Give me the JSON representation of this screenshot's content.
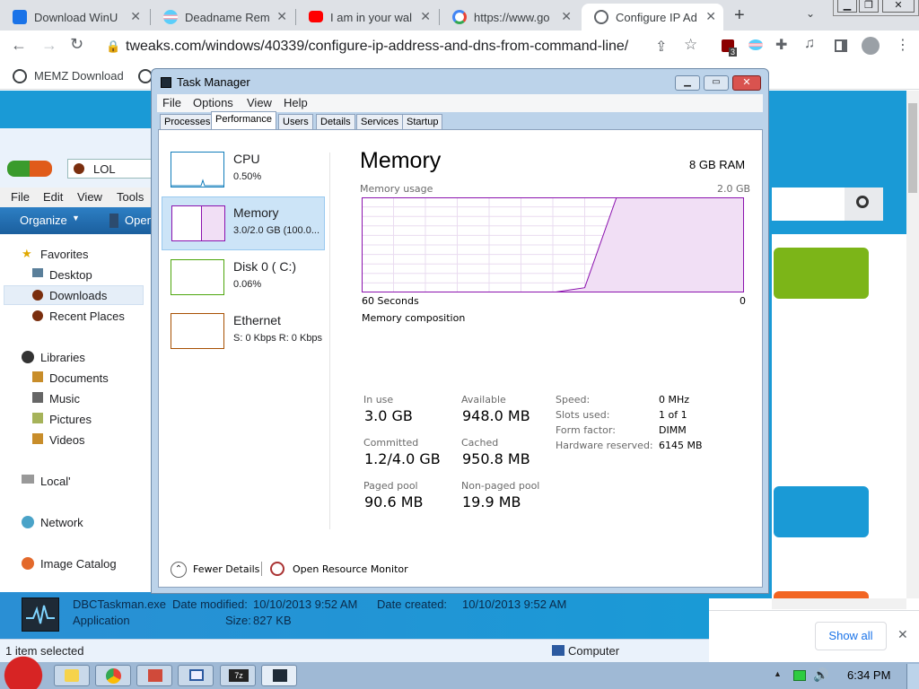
{
  "browser": {
    "tabs": [
      {
        "label": "Download WinU",
        "icon": "gear-icon",
        "color": "#1a73e8"
      },
      {
        "label": "Deadname Rem",
        "icon": "trans-flag-icon",
        "color": "#f5a9b8"
      },
      {
        "label": "I am in your wal",
        "icon": "youtube-icon",
        "color": "#ff0000"
      },
      {
        "label": "https://www.go",
        "icon": "google-icon",
        "color": "#4285f4"
      },
      {
        "label": "Configure IP Ad",
        "icon": "globe-icon",
        "color": "#5f6368"
      }
    ],
    "new_tab": "+",
    "url": "tweaks.com/windows/40339/configure-ip-address-and-dns-from-command-line/",
    "bookmark": "MEMZ Download",
    "ext_badge": "3"
  },
  "page": {
    "show_all": "Show all"
  },
  "explorer": {
    "breadcrumb": "LOL",
    "menu": [
      "File",
      "Edit",
      "View",
      "Tools"
    ],
    "organize": "Organize",
    "open": "Open",
    "nav": {
      "favorites": "Favorites",
      "desktop": "Desktop",
      "downloads": "Downloads",
      "recent": "Recent Places",
      "libraries": "Libraries",
      "documents": "Documents",
      "music": "Music",
      "pictures": "Pictures",
      "videos": "Videos",
      "local": "Local'",
      "network": "Network",
      "image_catalog": "Image Catalog"
    },
    "details": {
      "filename": "DBCTaskman.exe",
      "date_modified_label": "Date modified:",
      "date_modified": "10/10/2013 9:52 AM",
      "date_created_label": "Date created:",
      "date_created": "10/10/2013 9:52 AM",
      "type": "Application",
      "size_label": "Size:",
      "size": "827 KB"
    },
    "status": "1 item selected",
    "computer": "Computer"
  },
  "task_manager": {
    "title": "Task Manager",
    "menu": [
      "File",
      "Options",
      "View",
      "Help"
    ],
    "tabs": [
      "Processes",
      "Performance",
      "Users",
      "Details",
      "Services",
      "Startup"
    ],
    "sidebar": [
      {
        "name": "CPU",
        "value": "0.50%"
      },
      {
        "name": "Memory",
        "value": "3.0/2.0 GB (100.0..."
      },
      {
        "name": "Disk 0 ( C:)",
        "value": "0.06%"
      },
      {
        "name": "Ethernet",
        "value": "S: 0 Kbps R: 0 Kbps"
      }
    ],
    "heading": "Memory",
    "total": "8 GB RAM",
    "usage_label": "Memory usage",
    "usage_max": "2.0 GB",
    "x_left": "60 Seconds",
    "x_right": "0",
    "composition_label": "Memory composition",
    "stats": {
      "in_use_label": "In use",
      "in_use": "3.0 GB",
      "available_label": "Available",
      "available": "948.0 MB",
      "committed_label": "Committed",
      "committed": "1.2/4.0 GB",
      "cached_label": "Cached",
      "cached": "950.8 MB",
      "paged_label": "Paged pool",
      "paged": "90.6 MB",
      "nonpaged_label": "Non-paged pool",
      "nonpaged": "19.9 MB"
    },
    "hardware": {
      "speed_label": "Speed:",
      "speed": "0 MHz",
      "slots_label": "Slots used:",
      "slots": "1 of 1",
      "form_label": "Form factor:",
      "form": "DIMM",
      "reserved_label": "Hardware reserved:",
      "reserved": "6145 MB"
    },
    "fewer_details": "Fewer Details",
    "open_monitor": "Open Resource Monitor"
  },
  "chart_data": {
    "type": "area",
    "x": [
      60,
      55,
      50,
      45,
      40,
      35,
      30,
      25,
      20,
      15,
      10,
      5,
      0
    ],
    "y_fraction": [
      0,
      0,
      0,
      0,
      0,
      0,
      0,
      0.05,
      1,
      1,
      1,
      1,
      1
    ],
    "xlabel_left": "60 Seconds",
    "xlabel_right": "0",
    "ylim": [
      0,
      2.0
    ],
    "grid": true
  },
  "taskbar": {
    "clock": "6:34 PM"
  }
}
